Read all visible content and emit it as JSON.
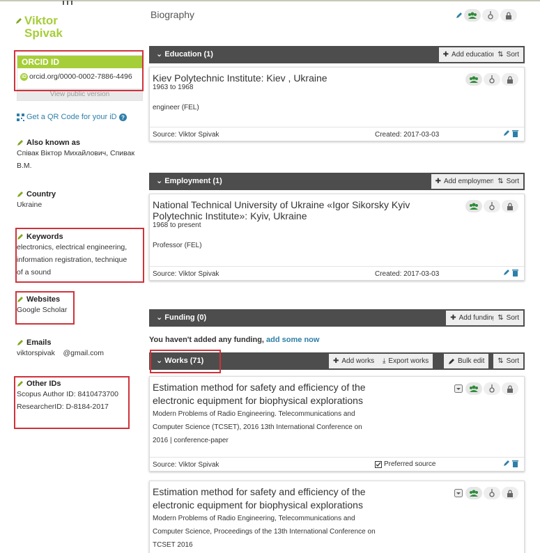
{
  "profile": {
    "name_line1": "Viktor",
    "name_line2": "Spivak",
    "orcid_header": "ORCID ID",
    "orcid_id": "orcid.org/0000-0002-7886-4496",
    "view_public": "View public version",
    "qr_link": "Get a QR Code for your iD",
    "also_known_label": "Also known as",
    "also_known_line1": "Співак Віктор Михайлович, Спивак",
    "also_known_line2": "В.М.",
    "country_label": "Country",
    "country_value": "Ukraine",
    "keywords_label": "Keywords",
    "keywords_line1": "electronics, electrical engineering,",
    "keywords_line2": "information registration, technique",
    "keywords_line3": "of a sound",
    "websites_label": "Websites",
    "website_link": "Google Scholar",
    "emails_label": "Emails",
    "email_value": "viktorspivak    @gmail.com",
    "other_ids_label": "Other IDs",
    "scopus_id": "Scopus Author ID: 8410473700",
    "researcher_id": "ResearcherID: D-8184-2017"
  },
  "biography": {
    "title": "Biography"
  },
  "education": {
    "title": "Education (1)",
    "add_label": "Add education",
    "sort_label": "Sort",
    "item": {
      "title": "Kiev Polytechnic Institute: Kiev , Ukraine",
      "dates": "1963 to 1968",
      "role": "engineer (FEL)",
      "source": "Source: Viktor Spivak",
      "created": "Created: 2017-03-03"
    }
  },
  "employment": {
    "title": "Employment (1)",
    "add_label": "Add employment",
    "sort_label": "Sort",
    "item": {
      "title_line1": "National Technical University of Ukraine «Igor Sikorsky Kyiv",
      "title_line2": "Polytechnic Institute»: Kyiv, Ukraine",
      "dates": "1968 to present",
      "role": "Professor (FEL)",
      "source": "Source: Viktor Spivak",
      "created": "Created: 2017-03-03"
    }
  },
  "funding": {
    "title": "Funding (0)",
    "add_label": "Add funding",
    "sort_label": "Sort",
    "empty_text": "You haven't added any funding,",
    "empty_link": "add some now"
  },
  "works": {
    "title": "Works (71)",
    "add_label": "Add works",
    "export_label": "Export works",
    "bulk_label": "Bulk edit",
    "sort_label": "Sort",
    "items": [
      {
        "title_line1": "Estimation method for safety and efficiency of the",
        "title_line2": "electronic equipment for biophysical explorations",
        "meta_line1": "Modern Problems of Radio Engineering. Telecommunications and",
        "meta_line2": "Computer Science (TCSET), 2016 13th International Conference on",
        "meta_line3": "2016 | conference-paper",
        "source": "Source: Viktor Spivak",
        "preferred": "Preferred source"
      },
      {
        "title_line1": "Estimation method for safety and efficiency of the",
        "title_line2": "electronic equipment for biophysical explorations",
        "meta_line1": "Modern Problems of Radio Engineering, Telecommunications and",
        "meta_line2": "Computer Science, Proceedings of the 13th International Conference on",
        "meta_line3": "TCSET 2016"
      }
    ]
  },
  "colors": {
    "orcid_green": "#a6ce39",
    "bar_dark": "#4d4d4d",
    "link_blue": "#2e7fa8",
    "highlight_red": "#d0323a"
  }
}
